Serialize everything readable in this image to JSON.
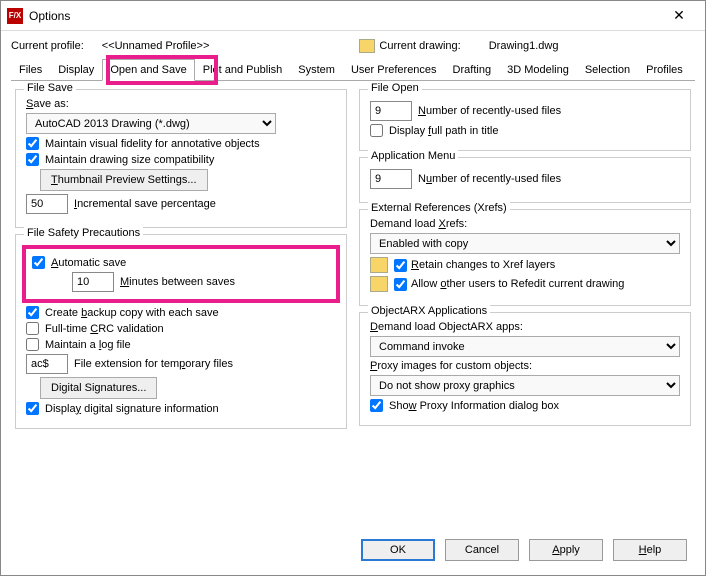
{
  "window": {
    "title": "Options"
  },
  "profile": {
    "label": "Current profile:",
    "value": "<<Unnamed Profile>>",
    "drawing_label": "Current drawing:",
    "drawing_value": "Drawing1.dwg"
  },
  "tabs": [
    "Files",
    "Display",
    "Open and Save",
    "Plot and Publish",
    "System",
    "User Preferences",
    "Drafting",
    "3D Modeling",
    "Selection",
    "Profiles"
  ],
  "file_save": {
    "title": "File Save",
    "save_as_label": "Save as:",
    "save_as_value": "AutoCAD 2013 Drawing (*.dwg)",
    "maintain_visual": "Maintain visual fidelity for annotative objects",
    "maintain_size": "Maintain drawing size compatibility",
    "thumbnail_btn": "Thumbnail Preview Settings...",
    "incremental_value": "50",
    "incremental_label": "Incremental save percentage"
  },
  "file_safety": {
    "title": "File Safety Precautions",
    "auto_save": "Automatic save",
    "minutes_value": "10",
    "minutes_label": "Minutes between saves",
    "backup": "Create backup copy with each save",
    "crc": "Full-time CRC validation",
    "log": "Maintain a log file",
    "ext_value": "ac$",
    "ext_label": "File extension for temporary files",
    "sig_btn": "Digital Signatures...",
    "display_sig": "Display digital signature information"
  },
  "file_open": {
    "title": "File Open",
    "recent_value": "9",
    "recent_label": "Number of recently-used files",
    "full_path": "Display full path in title"
  },
  "app_menu": {
    "title": "Application Menu",
    "recent_value": "9",
    "recent_label": "Number of recently-used files"
  },
  "xrefs": {
    "title": "External References (Xrefs)",
    "demand_label": "Demand load Xrefs:",
    "demand_value": "Enabled with copy",
    "retain": "Retain changes to Xref layers",
    "allow_others": "Allow other users to Refedit current drawing"
  },
  "objectarx": {
    "title": "ObjectARX Applications",
    "demand_label": "Demand load ObjectARX apps:",
    "demand_value": "Command invoke",
    "proxy_label": "Proxy images for custom objects:",
    "proxy_value": "Do not show proxy graphics",
    "show_proxy": "Show Proxy Information dialog box"
  },
  "footer": {
    "ok": "OK",
    "cancel": "Cancel",
    "apply": "Apply",
    "help": "Help"
  }
}
